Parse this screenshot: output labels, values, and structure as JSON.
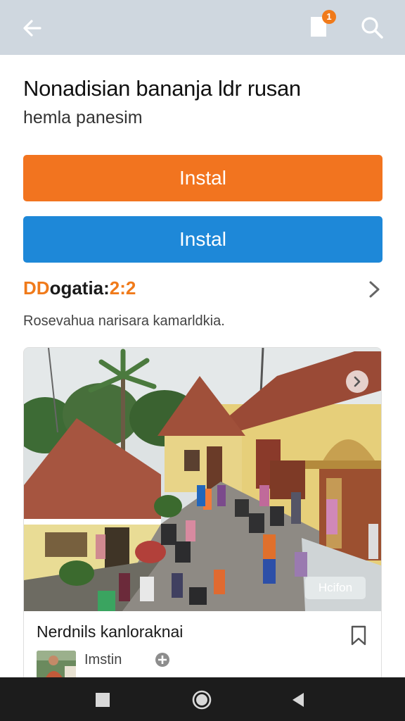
{
  "header": {
    "back_icon": "arrow-left-icon",
    "bookmark_icon": "bookmark-icon",
    "notification_count": "1",
    "search_icon": "search-icon",
    "background_color": "#cfd7df"
  },
  "app": {
    "title": "Nonadisian bananja ldr rusan",
    "subtitle": "hemla panesim"
  },
  "buttons": {
    "primary_label": "Instal",
    "primary_color": "#f2741f",
    "secondary_label": "Instal",
    "secondary_color": "#1e88d8"
  },
  "section": {
    "heading_part1": "DD",
    "heading_part2": "ogatia:",
    "heading_part3": "2:2",
    "description": "Rosevahua narisara kamarldkia."
  },
  "card": {
    "photo_chip_label": "Hcifon",
    "title": "Nerdnils kanloraknai",
    "author_name": "Imstin",
    "save_icon": "bookmark-outline-icon",
    "next_icon": "chevron-right-icon"
  },
  "system_nav": {
    "back": "square-icon",
    "home": "circle-home-icon",
    "recents": "triangle-back-icon"
  }
}
